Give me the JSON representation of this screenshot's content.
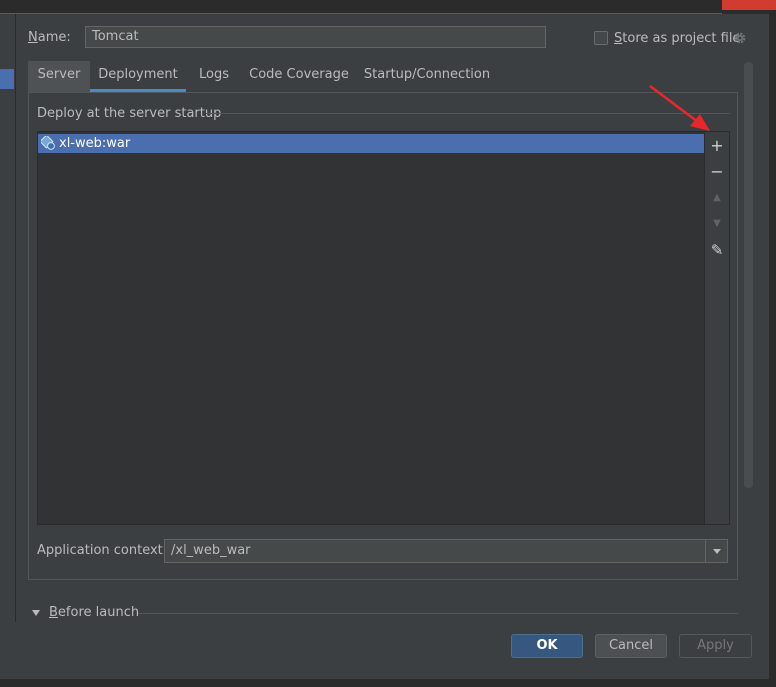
{
  "dialog": {
    "name_label_underlined": "N",
    "name_label_rest": "ame:",
    "name_value": "Tomcat",
    "store_label_underlined": "S",
    "store_label_rest": "tore as project file",
    "store_checked": false
  },
  "tabs": [
    {
      "label": "Server"
    },
    {
      "label": "Deployment"
    },
    {
      "label": "Logs"
    },
    {
      "label": "Code Coverage"
    },
    {
      "label": "Startup/Connection"
    }
  ],
  "deployment": {
    "section_label": "Deploy at the server startup",
    "artifacts": [
      {
        "label": "xl-web:war",
        "icon": "artifact-war-icon",
        "selected": true
      }
    ],
    "toolbar": {
      "add": "+",
      "remove": "−",
      "move_up": "▲",
      "move_down": "▼",
      "edit": "✎"
    },
    "context_label": "Application context:",
    "context_value": "/xl_web_war"
  },
  "before_launch": {
    "label_underlined": "B",
    "label_rest": "efore launch",
    "expanded": false
  },
  "buttons": {
    "ok": "OK",
    "cancel": "Cancel",
    "apply": "Apply"
  },
  "colors": {
    "background": "#3c3f41",
    "selection": "#4b6eaf",
    "accent_tab": "#4a88c7",
    "annotation_arrow": "#e8272b"
  }
}
